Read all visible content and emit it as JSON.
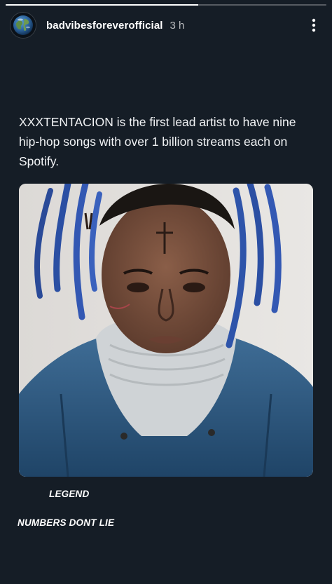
{
  "story": {
    "progress": 0.6,
    "username": "badvibesforeverofficial",
    "timestamp": "3 h",
    "avatar_icon": "globe-icon",
    "more_icon": "more-vertical-icon"
  },
  "post": {
    "headline": "XXXTENTACION is the first lead artist to have nine hip-hop songs with over 1 billion streams each on Spotify."
  },
  "stickers": {
    "legend": "LEGEND",
    "numbers": "NUMBERS DONT LIE"
  },
  "colors": {
    "background": "#151d26",
    "text": "#ffffff"
  }
}
